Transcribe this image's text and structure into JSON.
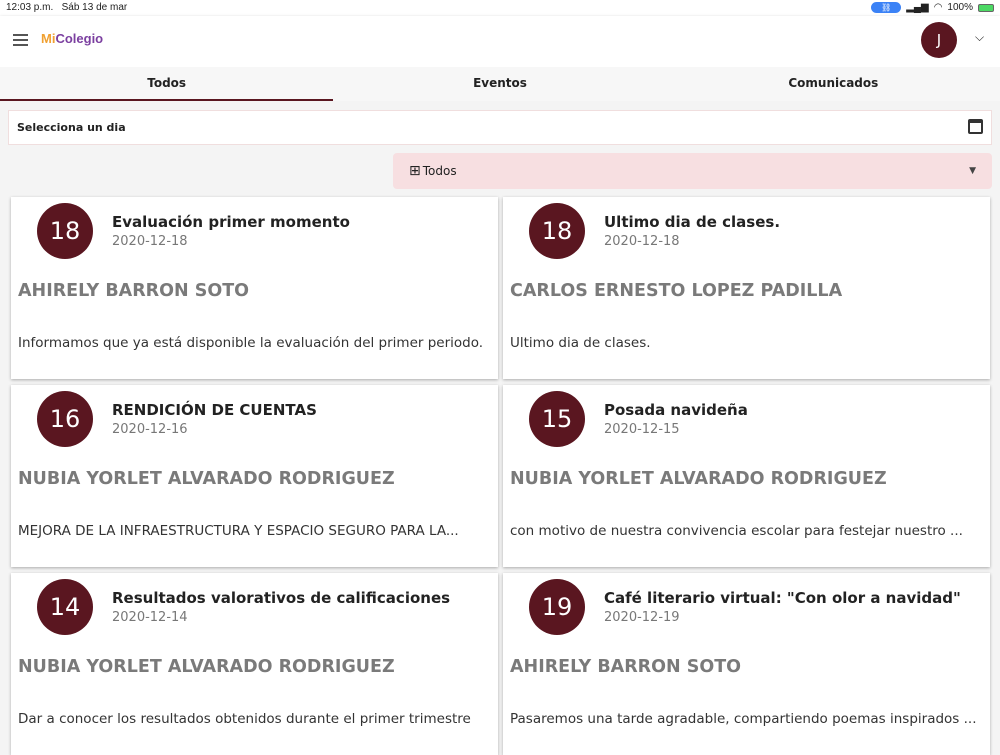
{
  "status": {
    "time": "12:03 p.m.",
    "date": "Sáb 13 de mar",
    "battery": "100%"
  },
  "header": {
    "logo_a": "Mi",
    "logo_b": "Colegio",
    "avatar": "J"
  },
  "tabs": [
    {
      "label": "Todos"
    },
    {
      "label": "Eventos"
    },
    {
      "label": "Comunicados"
    }
  ],
  "date_selector": {
    "label": "Selecciona un dia"
  },
  "filter": {
    "value": "Todos"
  },
  "colors": {
    "accent": "#5a1620",
    "filter_bg": "#f7dfe1"
  },
  "cards": [
    {
      "day": "18",
      "title": "Evaluación primer momento",
      "date": "2020-12-18",
      "author": "AHIRELY BARRON SOTO",
      "desc": "Informamos que ya está disponible la evaluación del primer periodo."
    },
    {
      "day": "18",
      "title": "Ultimo dia de clases.",
      "date": "2020-12-18",
      "author": "CARLOS ERNESTO LOPEZ PADILLA",
      "desc": "Ultimo dia de clases."
    },
    {
      "day": "16",
      "title": "RENDICIÓN DE CUENTAS",
      "date": "2020-12-16",
      "author": "NUBIA YORLET ALVARADO RODRIGUEZ",
      "desc": "MEJORA DE LA INFRAESTRUCTURA Y ESPACIO SEGURO PARA LA..."
    },
    {
      "day": "15",
      "title": "Posada navideña",
      "date": "2020-12-15",
      "author": "NUBIA YORLET ALVARADO RODRIGUEZ",
      "desc": "con motivo de nuestra convivencia escolar para festejar nuestro ..."
    },
    {
      "day": "14",
      "title": "Resultados valorativos de calificaciones",
      "date": "2020-12-14",
      "author": "NUBIA YORLET ALVARADO RODRIGUEZ",
      "desc": "Dar a conocer los resultados obtenidos durante el primer trimestre"
    },
    {
      "day": "19",
      "title": "Café literario virtual:  \"Con olor a navidad\"",
      "date": "2020-12-19",
      "author": "AHIRELY BARRON SOTO",
      "desc": "Pasaremos una tarde agradable, compartiendo poemas inspirados ..."
    }
  ]
}
